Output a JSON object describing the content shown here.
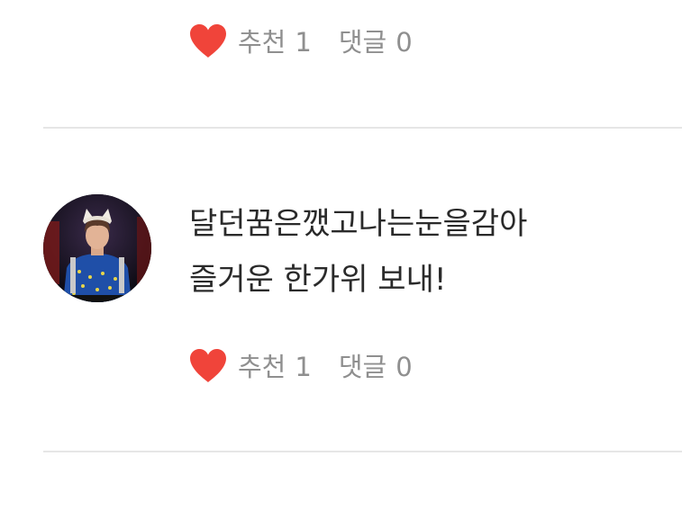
{
  "previous_comment": {
    "reactions": {
      "like_label": "추천",
      "like_count": "1",
      "comment_label": "댓글",
      "comment_count": "0"
    }
  },
  "comment": {
    "avatar": "profile-photo-avatar",
    "text_lines": [
      "달던꿈은깼고나는눈을감아",
      "즐거운 한가위 보내!"
    ],
    "reactions": {
      "like_label": "추천",
      "like_count": "1",
      "comment_label": "댓글",
      "comment_count": "0"
    }
  },
  "colors": {
    "heart": "#f0443a",
    "meta_text": "#8f8f8f",
    "comment_text": "#2a2a2a",
    "divider": "#e6e6e6"
  }
}
